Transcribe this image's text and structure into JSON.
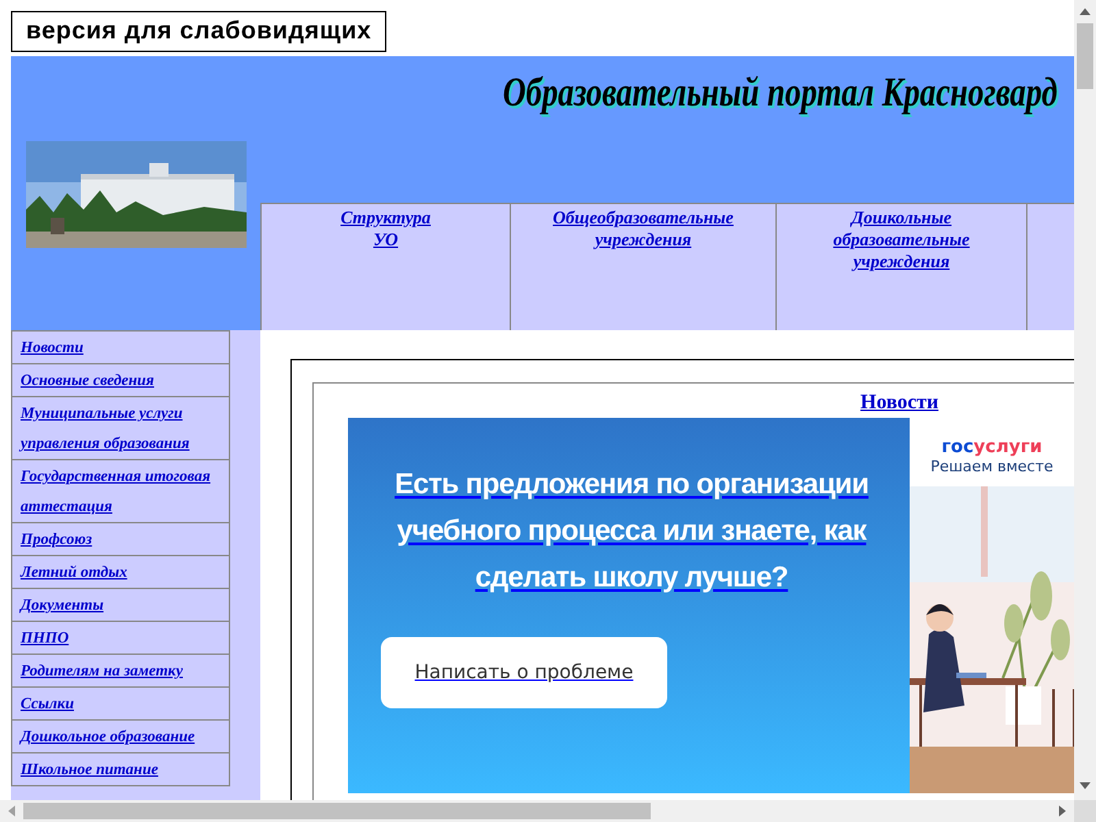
{
  "accessibility_button": "версия для слабовидящих",
  "header": {
    "title": "Образовательный портал Красногвард",
    "nav": [
      {
        "label": "Структура\nУО"
      },
      {
        "label": "Общеобразовательные\nучреждения"
      },
      {
        "label": "Дошкольные\nобразовательные\nучреждения"
      }
    ]
  },
  "sidebar": {
    "items": [
      {
        "label": "Новости"
      },
      {
        "label": "Основные сведения"
      },
      {
        "label": "Муниципальные услуги управления образования"
      },
      {
        "label": "Государственная итоговая аттестация"
      },
      {
        "label": "Профсоюз"
      },
      {
        "label": "Летний отдых"
      },
      {
        "label": "Документы"
      },
      {
        "label": "ПНПО"
      },
      {
        "label": "Родителям на заметку"
      },
      {
        "label": "Ссылки"
      },
      {
        "label": "Дошкольное образование"
      },
      {
        "label": "Школьное питание"
      }
    ]
  },
  "content": {
    "heading": "Новости",
    "banner": {
      "text": "Есть предложения по организации учебного процесса или знаете, как сделать школу лучше?",
      "button": "Написать о проблеме",
      "logo": [
        {
          "text": "гос",
          "color": "#0d4cd3"
        },
        {
          "text": "услуги",
          "color": "#ee3f58"
        }
      ],
      "tagline": "Решаем вместе"
    }
  }
}
